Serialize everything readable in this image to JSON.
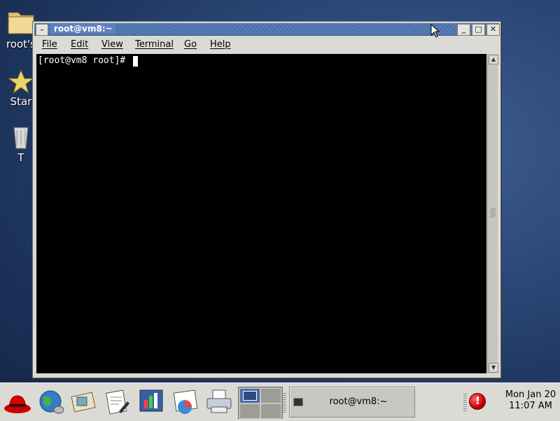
{
  "desktop": {
    "icons": [
      {
        "label": "root's",
        "icon": "home-folder-icon"
      },
      {
        "label": "Star",
        "icon": "start-here-icon"
      },
      {
        "label": "T",
        "icon": "trash-icon"
      }
    ]
  },
  "window": {
    "title": "root@vm8:~",
    "menu_button": "⌄",
    "minimize": "_",
    "maximize": "□",
    "close": "✕",
    "menus": [
      "File",
      "Edit",
      "View",
      "Terminal",
      "Go",
      "Help"
    ]
  },
  "terminal": {
    "prompt": "[root@vm8 root]# "
  },
  "panel": {
    "launchers": [
      "redhat-menu-icon",
      "web-browser-icon",
      "email-icon",
      "writer-icon",
      "presentation-icon",
      "spreadsheet-icon",
      "printer-icon"
    ],
    "task": {
      "label": "root@vm8:~"
    },
    "clock": {
      "date": "Mon Jan 20",
      "time": "11:07 AM"
    }
  },
  "colors": {
    "titlebar": "#4a6ea8",
    "desktop": "#2c4a7a",
    "terminal_bg": "#000000"
  }
}
